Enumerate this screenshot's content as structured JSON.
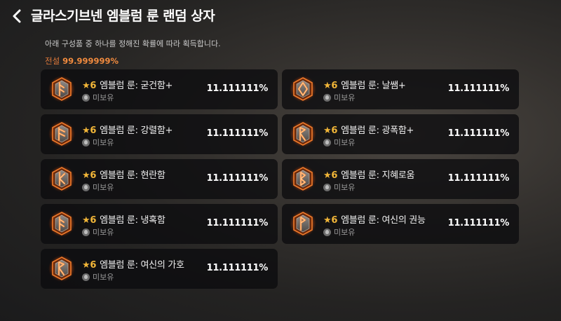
{
  "header": {
    "title": "글라스기브넨 엠블럼 룬 랜덤 상자",
    "back_icon": "chevron-left-icon"
  },
  "description": "아래 구성품 중 하나를 정해진 확률에 따라 획득합니다.",
  "rarity": {
    "label": "전설",
    "value": "99.999999%",
    "color": "#f08a3e"
  },
  "colors": {
    "accent": "#f08a3e",
    "star": "#f2b638"
  },
  "items": [
    {
      "star": "★",
      "grade": "6",
      "name": "엠블럼 룬: 굳건함+",
      "status": "미보유",
      "prob": "11.111111%",
      "icon": "rune-ansuz-icon"
    },
    {
      "star": "★",
      "grade": "6",
      "name": "엠블럼 룬: 날쌤+",
      "status": "미보유",
      "prob": "11.111111%",
      "icon": "rune-diamond-icon"
    },
    {
      "star": "★",
      "grade": "6",
      "name": "엠블럼 룬: 강렬함+",
      "status": "미보유",
      "prob": "11.111111%",
      "icon": "rune-fehu-icon"
    },
    {
      "star": "★",
      "grade": "6",
      "name": "엠블럼 룬: 광폭함+",
      "status": "미보유",
      "prob": "11.111111%",
      "icon": "rune-raido-icon"
    },
    {
      "star": "★",
      "grade": "6",
      "name": "엠블럼 룬: 현란함",
      "status": "미보유",
      "prob": "11.111111%",
      "icon": "rune-kaun-icon"
    },
    {
      "star": "★",
      "grade": "6",
      "name": "엠블럼 룬: 지혜로움",
      "status": "미보유",
      "prob": "11.111111%",
      "icon": "rune-berkano-icon"
    },
    {
      "star": "★",
      "grade": "6",
      "name": "엠블럼 룬: 냉혹함",
      "status": "미보유",
      "prob": "11.111111%",
      "icon": "rune-ansuz-icon"
    },
    {
      "star": "★",
      "grade": "6",
      "name": "엠블럼 룬: 여신의 권능",
      "status": "미보유",
      "prob": "11.111111%",
      "icon": "rune-wunjo-icon"
    },
    {
      "star": "★",
      "grade": "6",
      "name": "엠블럼 룬: 여신의 가호",
      "status": "미보유",
      "prob": "11.111111%",
      "icon": "rune-raido-icon"
    }
  ]
}
